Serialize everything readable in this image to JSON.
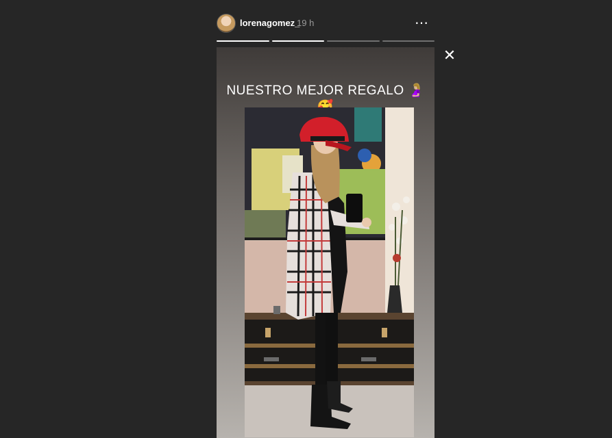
{
  "story": {
    "username": "lorenagomez_",
    "time": "19 h",
    "caption": "NUESTRO MEJOR REGALO 🤰🏼 🥰",
    "progress_segments": [
      1,
      1,
      0,
      0
    ],
    "more_icon": "⋯",
    "close_icon": "✕"
  },
  "colors": {
    "background": "#262626",
    "progress_active": "#ffffff",
    "progress_inactive": "rgba(255,255,255,0.35)"
  }
}
